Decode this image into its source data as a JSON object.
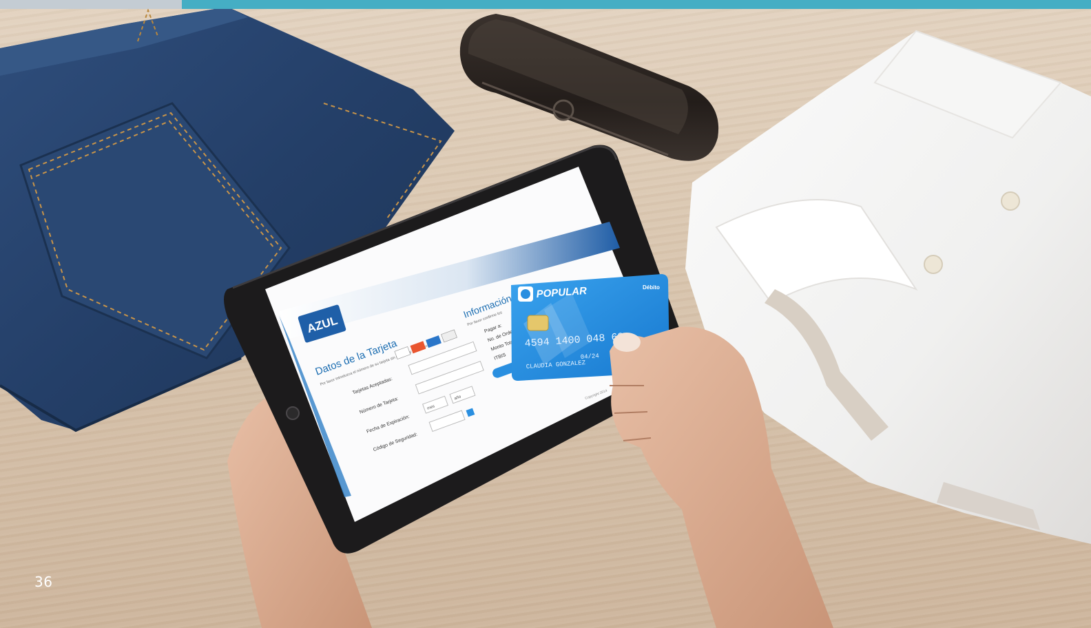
{
  "page": {
    "number": "36"
  },
  "colors": {
    "accent_teal": "#45aec4",
    "accent_grey": "#c4ccd3",
    "azul_blue": "#1b6db1",
    "card_blue": "#2a8fe0"
  },
  "tablet_screen": {
    "logo": "AZUL",
    "form_title": "Datos de la Tarjeta",
    "form_subtitle": "Por favor introduzca el número de su tarjeta sin guiones y sin espacios",
    "accepted_label": "Tarjetas Aceptadas:",
    "card_number_label": "Número de Tarjeta:",
    "expiry_label": "Fecha de Expiración:",
    "security_label": "Código de Seguridad:",
    "month_option": "mes",
    "year_option": "año",
    "info_title": "Información",
    "info_subtitle": "Por favor confirme los",
    "pay_label": "Pagar a:",
    "order_label": "No. de Orden:",
    "amount_label": "Monto Total:",
    "itbis_label": "ITBIS",
    "copyright": "Copyright 2014"
  },
  "credit_card": {
    "bank": "POPULAR",
    "type": "Débito",
    "number": "4594 1400 048  69",
    "expiry": "04/24",
    "holder": "CLAUDIA GONZALEZ"
  },
  "icons": [
    "jeans",
    "bluetooth-speaker",
    "folded-shirt",
    "tablet",
    "credit-card",
    "hand"
  ]
}
